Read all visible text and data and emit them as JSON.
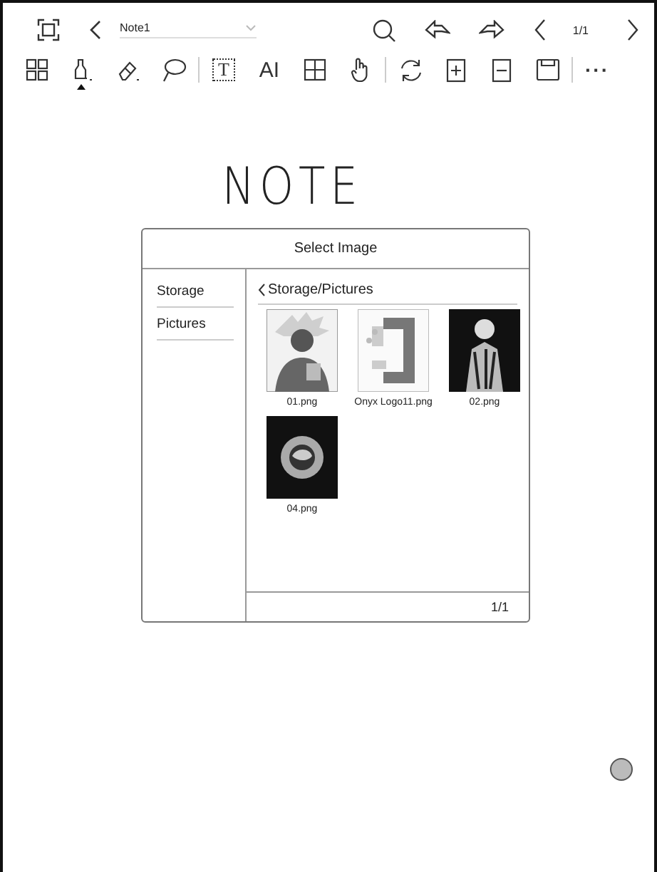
{
  "top_bar": {
    "note_title": "Note1",
    "page": "1/1"
  },
  "tool_groups": [
    [
      {
        "kind": "grid",
        "selected": false
      },
      {
        "kind": "pen",
        "selected": true
      },
      {
        "kind": "eraser",
        "selected": false
      },
      {
        "kind": "lasso",
        "selected": false
      }
    ],
    [
      {
        "kind": "text",
        "label": "T",
        "selected": false
      },
      {
        "kind": "ai",
        "label": "AI",
        "selected": false
      },
      {
        "kind": "table",
        "selected": false
      },
      {
        "kind": "hand",
        "selected": false
      }
    ],
    [
      {
        "kind": "rotate",
        "selected": false
      },
      {
        "kind": "add-page",
        "selected": false
      },
      {
        "kind": "remove-page",
        "selected": false
      },
      {
        "kind": "save",
        "selected": false
      }
    ],
    [
      {
        "kind": "more",
        "label": "···",
        "selected": false
      }
    ]
  ],
  "canvas": {
    "handwriting": "NOTE"
  },
  "dialog": {
    "title": "Select Image",
    "sources": [
      "Storage",
      "Pictures"
    ],
    "path": "Storage/Pictures",
    "files": [
      {
        "name": "01.png",
        "kind": "light"
      },
      {
        "name": "Onyx Logo11.png",
        "kind": "logo"
      },
      {
        "name": "02.png",
        "kind": "dark"
      },
      {
        "name": "04.png",
        "kind": "dark"
      }
    ],
    "page": "1/1"
  }
}
